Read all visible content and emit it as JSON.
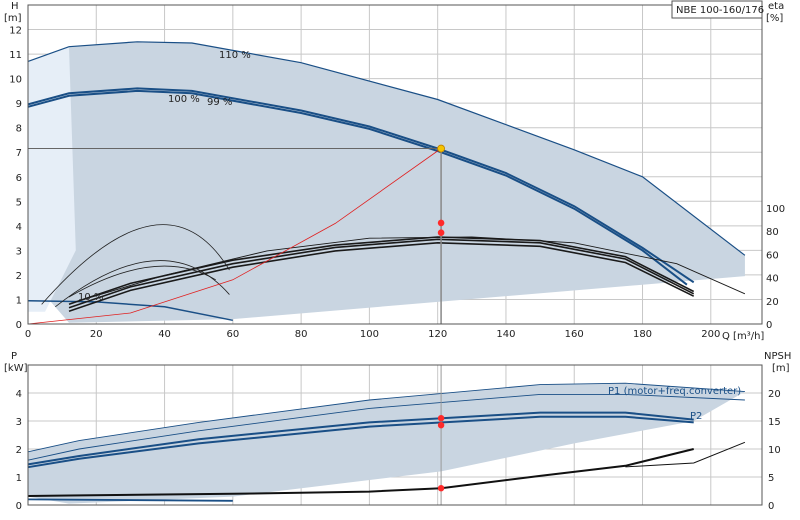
{
  "chart_data": [
    {
      "type": "line",
      "title": "NBE 100-160/176",
      "xlabel": "Q [m³/h]",
      "ylabel": "H [m]",
      "y2label": "eta [%]",
      "xlim": [
        0,
        215
      ],
      "ylim": [
        0,
        13
      ],
      "y2lim": [
        0,
        140
      ],
      "x_ticks": [
        "0",
        "20",
        "40",
        "60",
        "80",
        "100",
        "120",
        "140",
        "160",
        "180",
        "200"
      ],
      "y_ticks": [
        "0",
        "1",
        "2",
        "3",
        "4",
        "5",
        "6",
        "7",
        "8",
        "9",
        "10",
        "11",
        "12"
      ],
      "y2_ticks": [
        "0",
        "20",
        "40",
        "60",
        "80",
        "100"
      ],
      "grid": true,
      "head_curves": [
        {
          "label": "110 %",
          "x": [
            0,
            12,
            32,
            48,
            80,
            120,
            160,
            180,
            210
          ],
          "y": [
            10.7,
            11.3,
            11.5,
            11.45,
            10.65,
            9.15,
            7.1,
            6.0,
            2.8
          ]
        },
        {
          "label": "100 %",
          "x": [
            0,
            12,
            32,
            48,
            80,
            100,
            120,
            140,
            160,
            180,
            195
          ],
          "y": [
            8.95,
            9.4,
            9.6,
            9.5,
            8.7,
            8.05,
            7.15,
            6.15,
            4.8,
            3.1,
            1.7
          ]
        },
        {
          "label": "99 %",
          "x": [
            0,
            12,
            32,
            48,
            80,
            100,
            120,
            140,
            160,
            180,
            193
          ],
          "y": [
            8.85,
            9.3,
            9.5,
            9.4,
            8.6,
            7.95,
            7.05,
            6.05,
            4.7,
            3.0,
            1.6
          ]
        }
      ],
      "eta_curves": [
        {
          "x": [
            12,
            30,
            60,
            90,
            120,
            150,
            175,
            195
          ],
          "y": [
            17,
            35,
            55,
            68,
            75,
            72,
            58,
            28
          ]
        },
        {
          "x": [
            12,
            30,
            60,
            90,
            120,
            150,
            175,
            195
          ],
          "y": [
            14,
            32,
            52,
            66,
            73,
            70,
            56,
            26
          ]
        },
        {
          "x": [
            12,
            30,
            60,
            90,
            120,
            150,
            175,
            195
          ],
          "y": [
            11,
            29,
            49,
            63,
            70,
            67,
            53,
            24
          ]
        },
        {
          "x": [
            15,
            40,
            70,
            100,
            130,
            160,
            190,
            210
          ],
          "y": [
            20,
            42,
            63,
            74,
            75,
            70,
            52,
            26
          ]
        }
      ],
      "system_curve": {
        "x": [
          0,
          30,
          60,
          90,
          121
        ],
        "y": [
          0,
          0.45,
          1.8,
          4.1,
          7.15
        ]
      },
      "operating_point": {
        "x": 121,
        "y": 7.15
      },
      "eta_points": [
        {
          "x": 121,
          "y": 88.7
        },
        {
          "x": 121,
          "y": 80.8
        }
      ],
      "annotations": [
        "10 %"
      ]
    },
    {
      "type": "line",
      "xlabel": "",
      "ylabel": "P [kW]",
      "y2label": "NPSH [m]",
      "xlim": [
        0,
        215
      ],
      "ylim": [
        0,
        5
      ],
      "y2lim": [
        0,
        25
      ],
      "x_ticks": [],
      "y_ticks": [
        "0",
        "1",
        "2",
        "3",
        "4"
      ],
      "y2_ticks": [
        "0",
        "5",
        "10",
        "15",
        "20"
      ],
      "grid": true,
      "power_curves": [
        {
          "label": "P1 (motor+freq.converter)",
          "x": [
            0,
            15,
            50,
            100,
            150,
            175,
            210
          ],
          "y": [
            1.9,
            2.3,
            2.95,
            3.75,
            4.3,
            4.35,
            4.05
          ]
        },
        {
          "label": "P2",
          "x": [
            0,
            15,
            50,
            100,
            150,
            175,
            210
          ],
          "y": [
            1.6,
            2.0,
            2.65,
            3.45,
            3.95,
            3.95,
            3.75
          ]
        },
        {
          "label": "",
          "x": [
            0,
            15,
            50,
            100,
            150,
            175,
            195
          ],
          "y": [
            1.45,
            1.75,
            2.35,
            2.95,
            3.3,
            3.3,
            3.05
          ]
        },
        {
          "label": "",
          "x": [
            0,
            15,
            50,
            100,
            150,
            175,
            195
          ],
          "y": [
            1.35,
            1.65,
            2.2,
            2.8,
            3.15,
            3.15,
            2.95
          ]
        }
      ],
      "npsh_curves": [
        {
          "x": [
            12,
            60,
            100,
            121,
            150,
            175,
            195
          ],
          "y": [
            1.7,
            2.0,
            2.4,
            3.0,
            5.2,
            7.0,
            10.0
          ]
        },
        {
          "x": [
            175,
            195,
            210
          ],
          "y": [
            6.8,
            7.5,
            11.2
          ]
        }
      ],
      "power_points": [
        {
          "x": 121,
          "y": 3.1
        },
        {
          "x": 121,
          "y": 2.85
        }
      ],
      "npsh_point": {
        "x": 121,
        "y": 3.0
      }
    }
  ],
  "labels": {
    "title": "NBE 100-160/176",
    "h_axis": "H",
    "h_unit": "[m]",
    "eta_axis": "eta",
    "eta_unit": "[%]",
    "q_axis": "Q [m³/h]",
    "p_axis": "P",
    "p_unit": "[kW]",
    "npsh_axis": "NPSH",
    "npsh_unit": "[m]",
    "curve_110": "110 %",
    "curve_100": "100 %",
    "curve_99": "99 %",
    "curve_10": "10 %",
    "p1_label": "P1 (motor+freq.converter)",
    "p2_label": "P2"
  },
  "colors": {
    "envelope": "#c9d5e1",
    "envelope_light": "#e6eef7",
    "blue_curve": "#1a4f86",
    "eta_curve": "#1a1a1a",
    "system_curve": "#e02020",
    "operating_point": "#f5c400",
    "marker": "#ff2a2a"
  }
}
